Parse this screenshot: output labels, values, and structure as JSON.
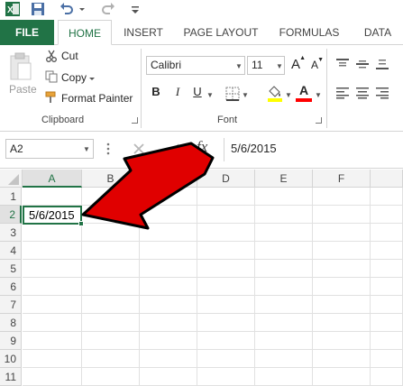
{
  "quick_access": {
    "icons": [
      "excel-logo",
      "save",
      "undo",
      "redo",
      "customize"
    ]
  },
  "tabs": [
    {
      "label": "FILE"
    },
    {
      "label": "HOME"
    },
    {
      "label": "INSERT"
    },
    {
      "label": "PAGE LAYOUT"
    },
    {
      "label": "FORMULAS"
    },
    {
      "label": "DATA"
    }
  ],
  "clipboard": {
    "paste_label": "Paste",
    "cut_label": "Cut",
    "copy_label": "Copy",
    "format_painter_label": "Format Painter",
    "group_label": "Clipboard"
  },
  "font": {
    "font_name": "Calibri",
    "font_size": "11",
    "bold": "B",
    "italic": "I",
    "underline": "U",
    "font_color_letter": "A",
    "grow_letter": "A",
    "shrink_letter": "A",
    "group_label": "Font",
    "fill_color": "#ffff00",
    "text_color": "#ff0000"
  },
  "formula_bar": {
    "name_box": "A2",
    "fx": "fx",
    "value": "5/6/2015"
  },
  "grid": {
    "columns": [
      "A",
      "B",
      "C",
      "D",
      "E",
      "F"
    ],
    "rows": [
      "1",
      "2",
      "3",
      "4",
      "5",
      "6",
      "7",
      "8",
      "9",
      "10",
      "11"
    ],
    "active_cell": "A2",
    "a2_value": "5/6/2015"
  },
  "annotation": {
    "arrow_color": "#e00000"
  },
  "colors": {
    "accent": "#217346"
  }
}
